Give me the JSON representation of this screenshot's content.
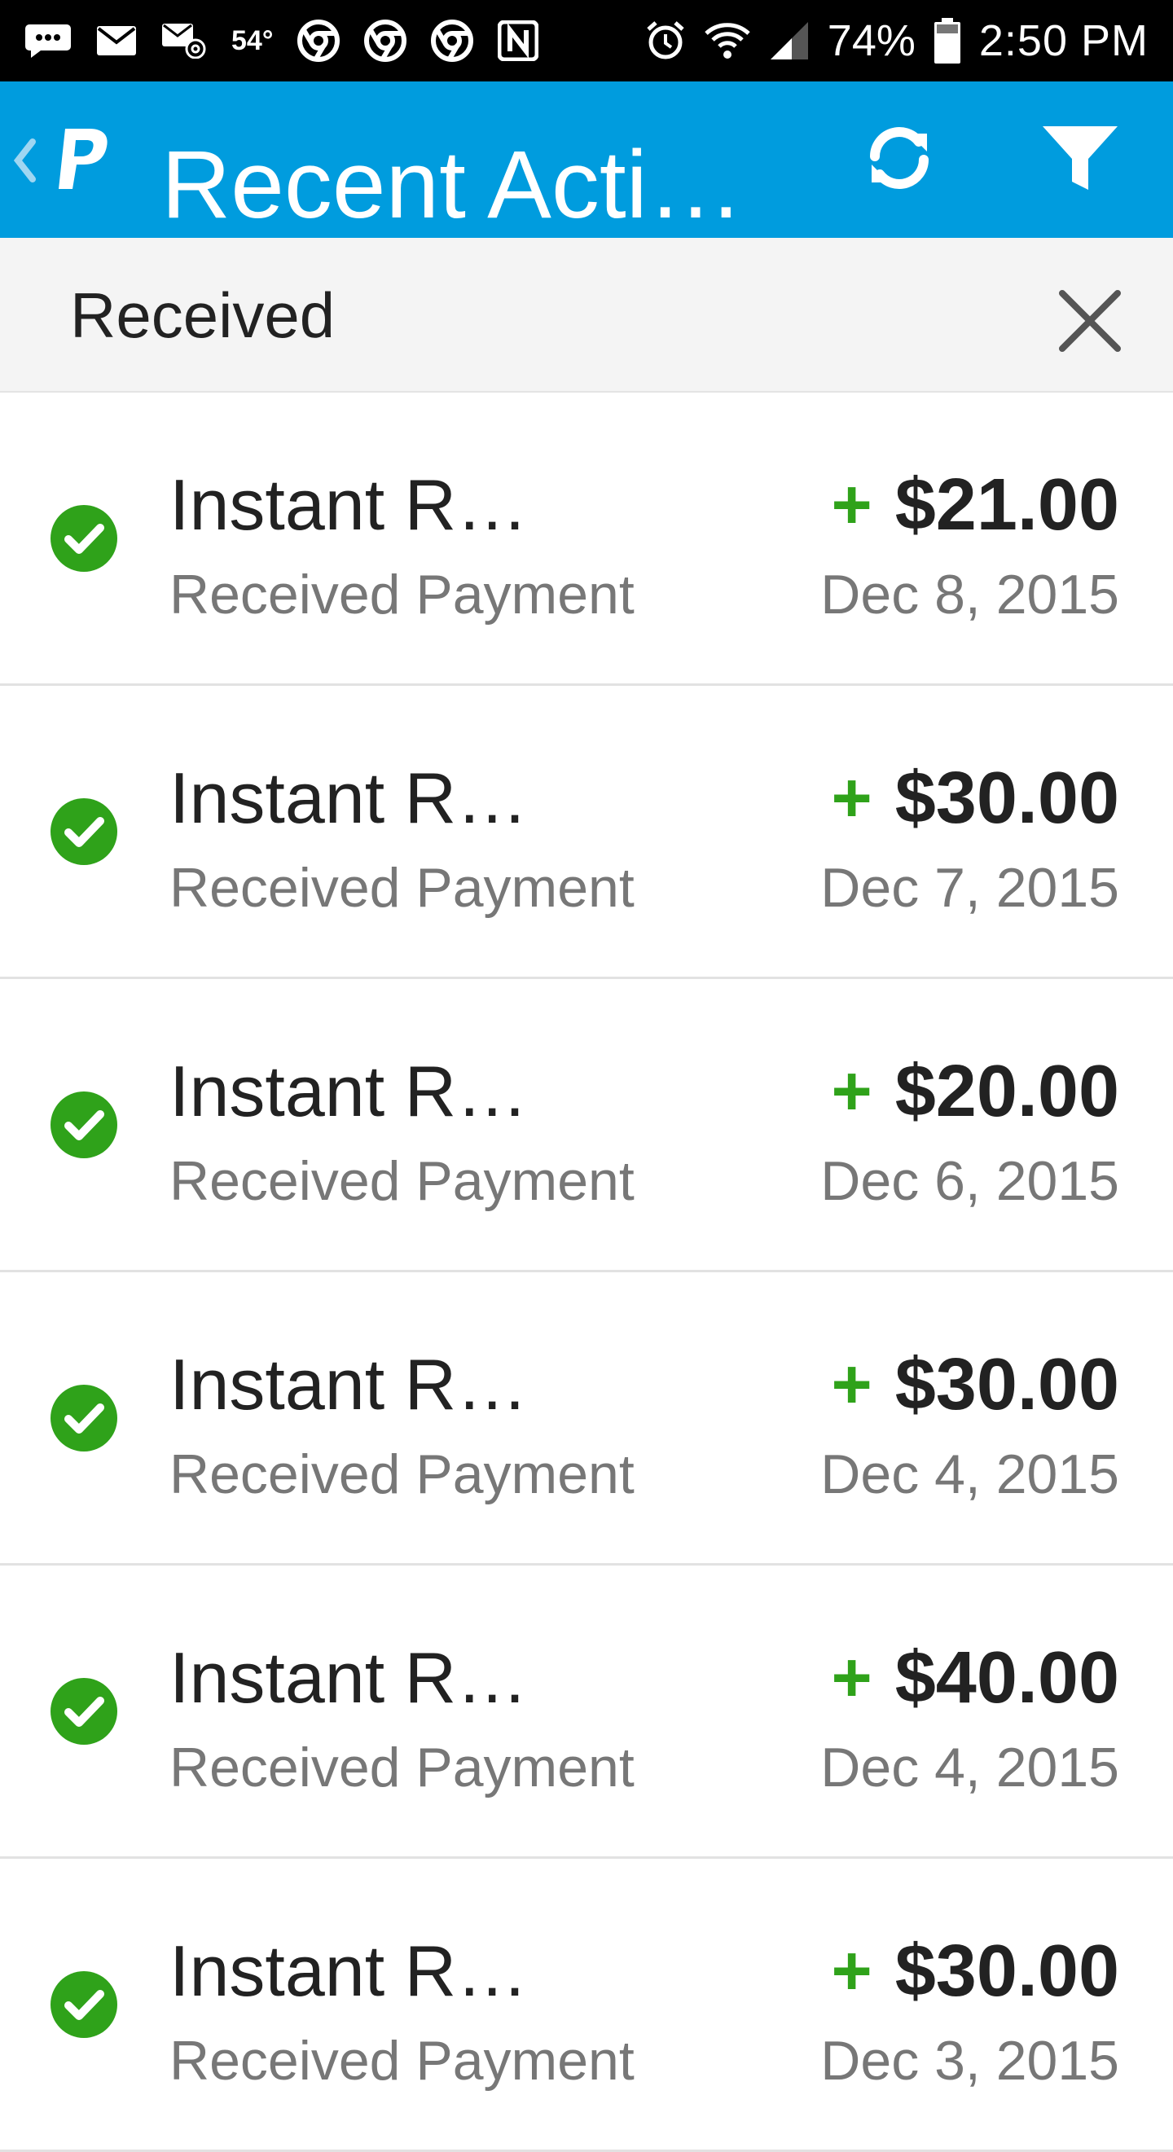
{
  "status_bar": {
    "temperature": "54°",
    "battery": "74%",
    "time": "2:50 PM",
    "icons": [
      "messages-icon",
      "mail-icon",
      "email-at-icon",
      "chrome-icon",
      "chrome-icon",
      "chrome-icon",
      "nfc-icon",
      "alarm-icon",
      "wifi-icon",
      "signal-icon",
      "battery-icon"
    ]
  },
  "app_bar": {
    "title": "Recent Acti…",
    "background": "#009cde",
    "icons": [
      "back-chevron-icon",
      "paypal-logo",
      "refresh-icon",
      "filter-icon"
    ]
  },
  "filter": {
    "label": "Received",
    "close_icon": "close-icon"
  },
  "accent_colors": {
    "positive": "#2fa21a",
    "check_green": "#2fa21a"
  },
  "transactions": [
    {
      "title": "Instant R…",
      "subtitle": "Received Payment",
      "sign": "+",
      "amount": "$21.00",
      "date": "Dec 8, 2015"
    },
    {
      "title": "Instant R…",
      "subtitle": "Received Payment",
      "sign": "+",
      "amount": "$30.00",
      "date": "Dec 7, 2015"
    },
    {
      "title": "Instant R…",
      "subtitle": "Received Payment",
      "sign": "+",
      "amount": "$20.00",
      "date": "Dec 6, 2015"
    },
    {
      "title": "Instant R…",
      "subtitle": "Received Payment",
      "sign": "+",
      "amount": "$30.00",
      "date": "Dec 4, 2015"
    },
    {
      "title": "Instant R…",
      "subtitle": "Received Payment",
      "sign": "+",
      "amount": "$40.00",
      "date": "Dec 4, 2015"
    },
    {
      "title": "Instant R…",
      "subtitle": "Received Payment",
      "sign": "+",
      "amount": "$30.00",
      "date": "Dec 3, 2015"
    }
  ]
}
